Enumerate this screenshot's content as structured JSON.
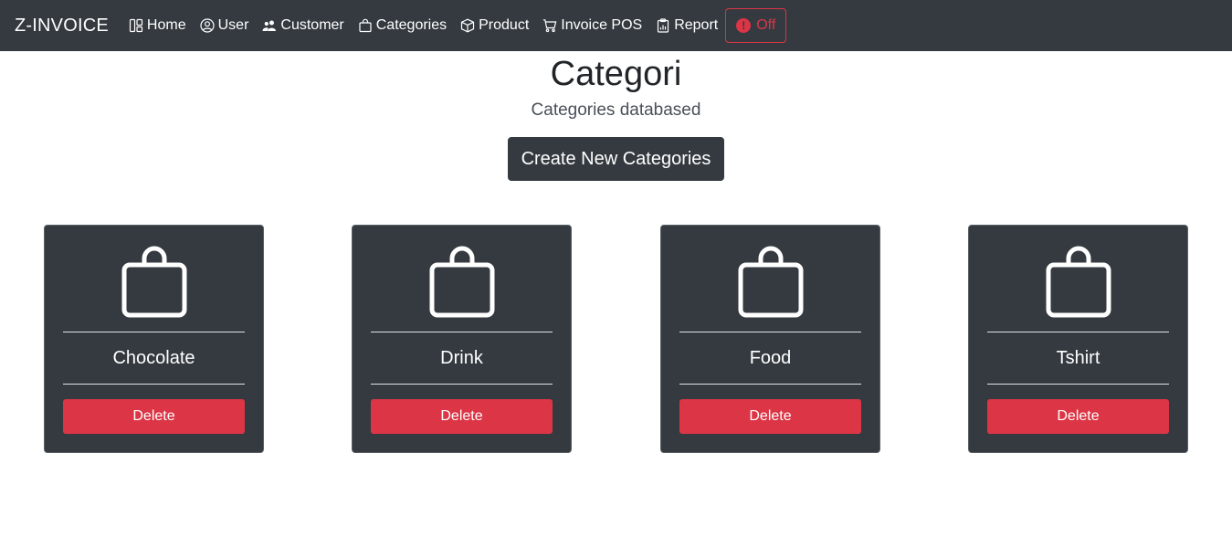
{
  "nav": {
    "brand": "Z-INVOICE",
    "items": [
      {
        "label": "Home",
        "icon": "layout-icon"
      },
      {
        "label": "User",
        "icon": "user-circle-icon"
      },
      {
        "label": "Customer",
        "icon": "people-icon"
      },
      {
        "label": "Categories",
        "icon": "bag-icon"
      },
      {
        "label": "Product",
        "icon": "box-icon"
      },
      {
        "label": "Invoice POS",
        "icon": "cart-icon"
      },
      {
        "label": "Report",
        "icon": "clipboard-data-icon"
      }
    ],
    "off_label": "Off",
    "off_icon": "exclamation-circle-icon"
  },
  "header": {
    "title": "Categori",
    "subtitle": "Categories databased"
  },
  "create_button": "Create New Categories",
  "categories": [
    {
      "name": "Chocolate",
      "delete_label": "Delete",
      "icon": "bag-icon"
    },
    {
      "name": "Drink",
      "delete_label": "Delete",
      "icon": "bag-icon"
    },
    {
      "name": "Food",
      "delete_label": "Delete",
      "icon": "bag-icon"
    },
    {
      "name": "Tshirt",
      "delete_label": "Delete",
      "icon": "bag-icon"
    }
  ],
  "colors": {
    "navbar": "#343a40",
    "card": "#343a40",
    "danger": "#dc3545",
    "text_light": "#ffffff"
  }
}
